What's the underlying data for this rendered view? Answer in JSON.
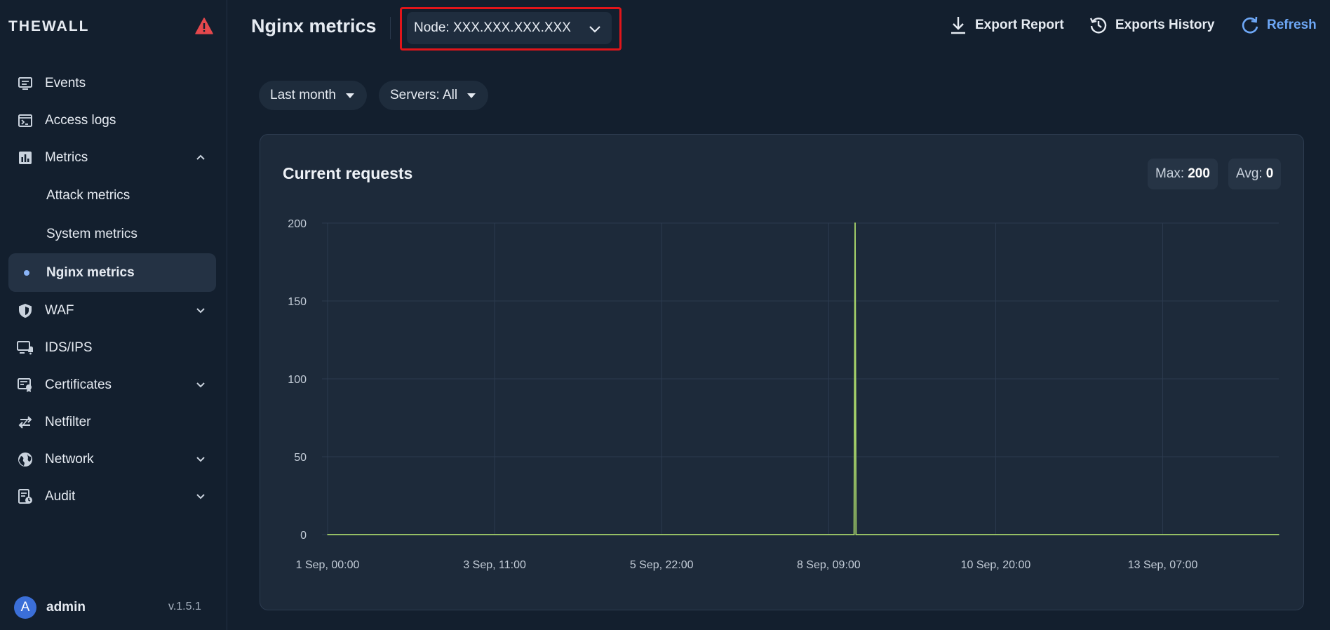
{
  "brand": "THEWALL",
  "sidebar": {
    "items": [
      {
        "label": "Events",
        "icon": "monitor-icon"
      },
      {
        "label": "Access logs",
        "icon": "terminal-icon"
      },
      {
        "label": "Metrics",
        "icon": "bar-chart-icon",
        "expanded": true
      },
      {
        "label": "WAF",
        "icon": "shield-icon"
      },
      {
        "label": "IDS/IPS",
        "icon": "monitor-bell-icon"
      },
      {
        "label": "Certificates",
        "icon": "certificate-icon"
      },
      {
        "label": "Netfilter",
        "icon": "swap-arrows-icon"
      },
      {
        "label": "Network",
        "icon": "globe-icon"
      },
      {
        "label": "Audit",
        "icon": "audit-doc-icon"
      }
    ],
    "metrics_children": [
      "Attack metrics",
      "System metrics",
      "Nginx metrics"
    ],
    "active": "Nginx metrics"
  },
  "user": {
    "initial": "A",
    "name": "admin",
    "version": "v.1.5.1"
  },
  "header": {
    "title": "Nginx metrics",
    "node_select": "Node: XXX.XXX.XXX.XXX",
    "export_report": "Export Report",
    "exports_history": "Exports History",
    "refresh": "Refresh"
  },
  "filters": {
    "period": "Last month",
    "servers": "Servers: All"
  },
  "colors": {
    "accent": "#6ea8f7",
    "series": "#a6d36a",
    "alert": "#e5484d",
    "highlight": "#e1151a"
  },
  "card": {
    "title": "Current requests",
    "max_label": "Max:",
    "max_value": "200",
    "avg_label": "Avg:",
    "avg_value": "0"
  },
  "chart_data": {
    "type": "line",
    "title": "Current requests",
    "xlabel": "",
    "ylabel": "",
    "ylim": [
      0,
      200
    ],
    "yticks": [
      0,
      50,
      100,
      150,
      200
    ],
    "xlim": [
      "2023-09-01T00:00",
      "2023-09-15T00:00"
    ],
    "xtick_labels": [
      {
        "t": "2023-09-01T00:00",
        "label": "1 Sep, 00:00"
      },
      {
        "t": "2023-09-03T11:00",
        "label": "3 Sep, 11:00"
      },
      {
        "t": "2023-09-05T22:00",
        "label": "5 Sep, 22:00"
      },
      {
        "t": "2023-09-08T09:00",
        "label": "8 Sep, 09:00"
      },
      {
        "t": "2023-09-10T20:00",
        "label": "10 Sep, 20:00"
      },
      {
        "t": "2023-09-13T07:00",
        "label": "13 Sep, 07:00"
      }
    ],
    "grid": true,
    "series": [
      {
        "points": [
          [
            "2023-09-01T00:00",
            0
          ],
          [
            "2023-09-08T18:00",
            0
          ],
          [
            "2023-09-08T18:20",
            200
          ],
          [
            "2023-09-08T18:40",
            0
          ],
          [
            "2023-09-15T00:00",
            0
          ]
        ]
      }
    ]
  }
}
